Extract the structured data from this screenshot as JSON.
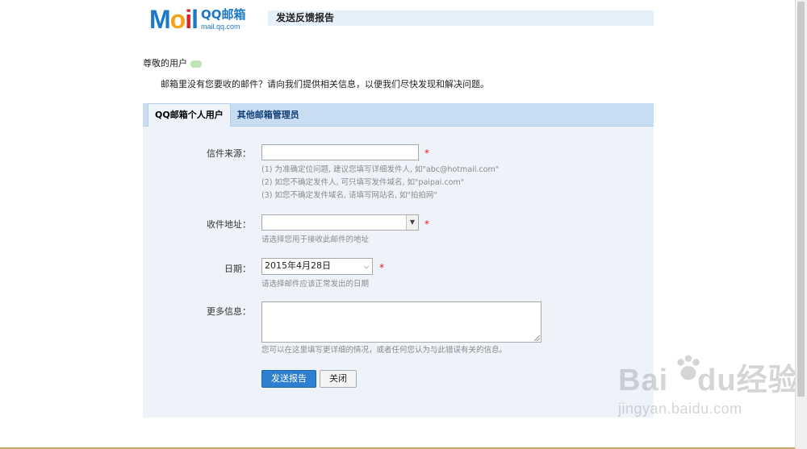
{
  "logo": {
    "mail_m": "M",
    "mail_o": "o",
    "mail_i": "i",
    "mail_l": "l",
    "qq_text": "QQ邮箱",
    "url_text": "mail.qq.com"
  },
  "page_title": "发送反馈报告",
  "greeting": "尊敬的用户",
  "intro": "邮箱里没有您要收的邮件？请向我们提供相关信息，以便我们尽快发现和解决问题。",
  "tabs": [
    {
      "label": "QQ邮箱个人用户",
      "active": true
    },
    {
      "label": "其他邮箱管理员",
      "active": false
    }
  ],
  "form": {
    "source": {
      "label": "信件来源：",
      "value": "",
      "hints": [
        "(1) 为准确定位问题, 建议您填写详细发件人, 如\"abc@hotmail.com\"",
        "(2) 如您不确定发件人, 可只填写发件域名, 如\"paipai.com\"",
        "(3) 如您不确定发件域名, 请填写网站名, 如\"拍拍网\""
      ]
    },
    "address": {
      "label": "收件地址：",
      "value": "",
      "hint": "请选择您用于接收此邮件的地址"
    },
    "date": {
      "label": "日期：",
      "value": "2015年4月28日",
      "hint": "请选择邮件应该正常发出的日期"
    },
    "more": {
      "label": "更多信息：",
      "value": "",
      "hint": "您可以在这里填写更详细的情况，或者任何您认为与此错误有关的信息。"
    },
    "required_mark": "*"
  },
  "buttons": {
    "submit": "发送报告",
    "close": "关闭"
  },
  "watermark": {
    "line1_a": "Bai",
    "line1_b": "du",
    "line1_c": "经验",
    "line2": "jingyan.baidu.com"
  },
  "colors": {
    "accent": "#2f7fd0",
    "tab_bar": "#c8dcf2",
    "panel_bg": "#eef3fa",
    "required": "#e02020"
  }
}
